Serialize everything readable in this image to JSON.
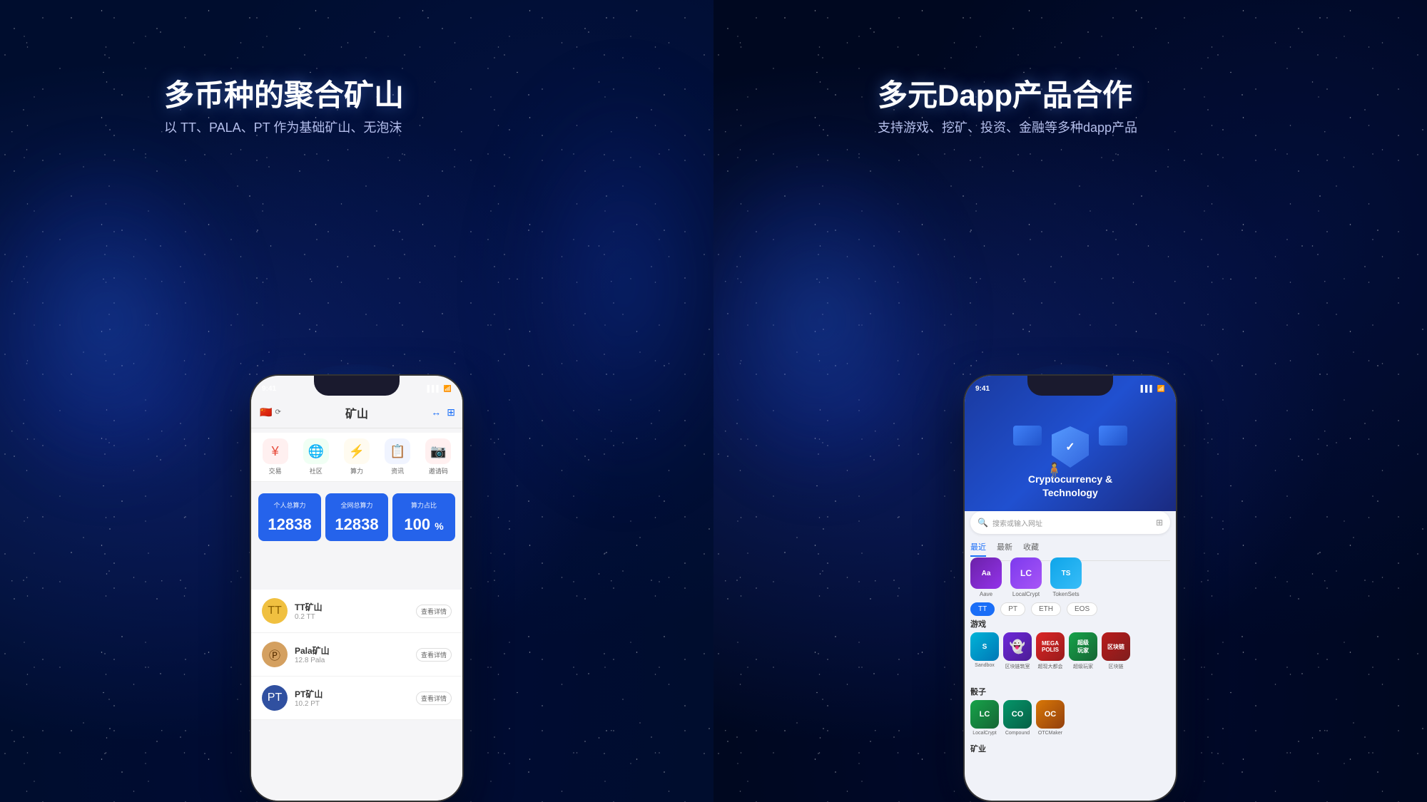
{
  "left": {
    "title": "多币种的聚合矿山",
    "subtitle": "以 TT、PALA、PT 作为基础矿山、无泡沫",
    "phone": {
      "status_time": "9:41",
      "header_title": "矿山",
      "nav_items": [
        {
          "label": "交易",
          "icon": "¥"
        },
        {
          "label": "社区",
          "icon": "🌐"
        },
        {
          "label": "算力",
          "icon": "⚡"
        },
        {
          "label": "资讯",
          "icon": "📋"
        },
        {
          "label": "邀请码",
          "icon": "📷"
        }
      ],
      "stats": [
        {
          "label": "个人总算力",
          "value": "12838"
        },
        {
          "label": "全网总算力",
          "value": "12838"
        },
        {
          "label": "算力占比",
          "value": "100",
          "unit": "%"
        }
      ],
      "mining_items": [
        {
          "name": "TT矿山",
          "amount": "0.2 TT",
          "btn": "查看详情",
          "color": "tt"
        },
        {
          "name": "Pala矿山",
          "amount": "12.8 Pala",
          "btn": "查看详情",
          "color": "pala"
        },
        {
          "name": "PT矿山",
          "amount": "10.2 PT",
          "btn": "查看详情",
          "color": "pt"
        }
      ]
    }
  },
  "right": {
    "title": "多元Dapp产品合作",
    "subtitle": "支持游戏、挖矿、投资、金融等多种dapp产品",
    "phone": {
      "status_time": "9:41",
      "header_title_line1": "Cryptocurrency &",
      "header_title_line2": "Technology",
      "search_placeholder": "搜索或输入网址",
      "tabs": [
        "最近",
        "最新",
        "收藏"
      ],
      "active_tab": "最近",
      "recent_dapps": [
        {
          "name": "Aave",
          "color": "aave"
        },
        {
          "name": "LocalCrypt",
          "color": "loca"
        },
        {
          "name": "TokenSets",
          "color": "token"
        }
      ],
      "chain_tabs": [
        "TT",
        "PT",
        "ETH",
        "EOS"
      ],
      "active_chain": "TT",
      "section_games": "游戏",
      "games": [
        {
          "name": "Sandbox",
          "color": "sandbox"
        },
        {
          "name": "区块链筑室",
          "color": "chain"
        },
        {
          "name": "超现大都会",
          "color": "mega"
        },
        {
          "name": "超级玩家",
          "color": "super"
        },
        {
          "name": "区块链",
          "color": "block"
        }
      ],
      "section_dice": "骰子",
      "finance": [
        {
          "name": "LocalCrypt",
          "color": "loca2"
        },
        {
          "name": "Compound",
          "color": "compound"
        },
        {
          "name": "OTCMaker",
          "color": "otc"
        }
      ],
      "section_mining": "矿业"
    }
  }
}
